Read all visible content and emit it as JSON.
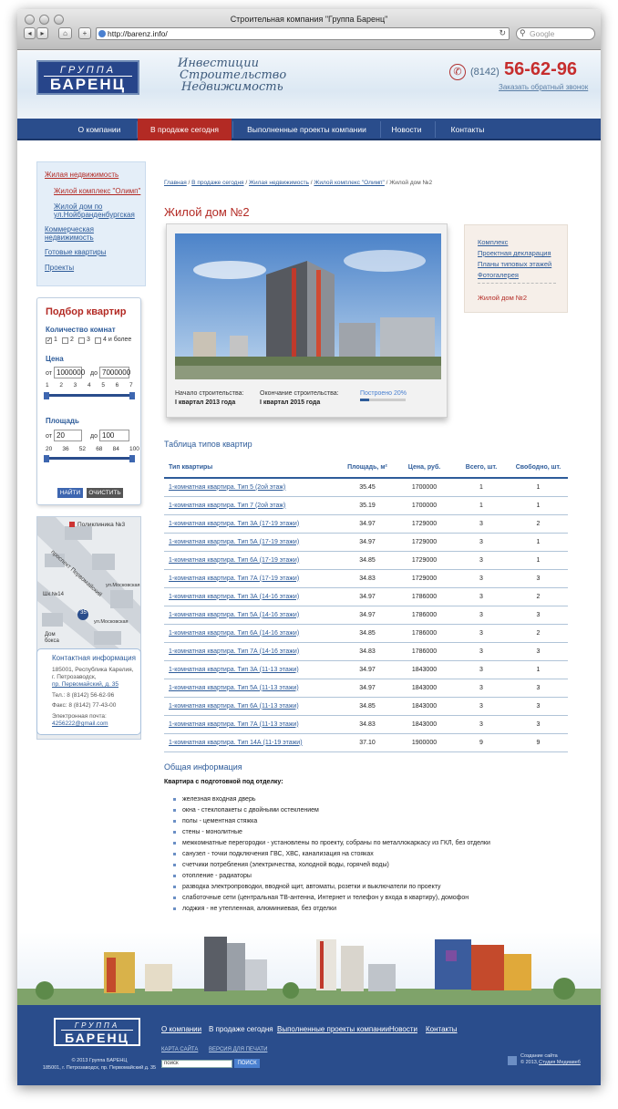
{
  "browser": {
    "title": "Строительная компания \"Группа Баренц\"",
    "url": "http://barenz.info/",
    "search_placeholder": "Google"
  },
  "header": {
    "logo_top": "ГРУППА",
    "logo_bottom": "БАРЕНЦ",
    "tagline": [
      "Инвестиции",
      "Строительство",
      "Недвижимость"
    ],
    "phone_code": "(8142)",
    "phone": "56-62-96",
    "callback": "Заказать обратный звонок"
  },
  "nav": [
    "О компании",
    "В продаже сегодня",
    "Выполненные проекты компании",
    "Новости",
    "Контакты"
  ],
  "leftmenu": {
    "items": [
      "Жилая недвижимость",
      "Жилой комплекс \"Олимп\"",
      "Жилой дом по",
      "ул.Нойбранденбургская",
      "Коммерческая",
      "недвижимость",
      "Готовые квартиры",
      "Проекты"
    ]
  },
  "filter": {
    "title": "Подбор квартир",
    "rooms_label": "Количество комнат",
    "rooms": [
      "1",
      "2",
      "3",
      "4 и более"
    ],
    "price_label": "Цена",
    "from": "от",
    "to": "до",
    "price_from": "1000000",
    "price_to": "7000000",
    "price_ticks": [
      "1",
      "2",
      "3",
      "4",
      "5",
      "6",
      "7"
    ],
    "area_label": "Площадь",
    "area_from": "20",
    "area_to": "100",
    "area_ticks": [
      "20",
      "36",
      "52",
      "68",
      "84",
      "100"
    ],
    "find": "НАЙТИ",
    "clear": "ОЧИСТИТЬ"
  },
  "map": {
    "clinic": "Поликлиника №3",
    "prospect": "проспект Первомайский",
    "street1": "ул.Московская",
    "street2": "ул.Московская",
    "school": "Шк.№14",
    "sport": "Дом",
    "sport2": "бокса",
    "num": "35"
  },
  "contact": {
    "title": "Контактная информация",
    "lines": [
      "185001, Республика Карелия,",
      "г. Петрозаводск,",
      "пр. Первомайский, д. 35",
      "Тел.: 8 (8142) 56-62-96",
      "Факс: 8 (8142) 77-43-00",
      "Электронная почта:",
      "4256222@gmail.com"
    ]
  },
  "breadcrumb": [
    "Главная",
    "В продаже сегодня",
    "Жилая недвижимость",
    "Жилой комплекс \"Олимп\"",
    "Жилой дом №2"
  ],
  "page_title": "Жилой дом №2",
  "photo_card": {
    "start_label": "Начало строительства:",
    "start_value": "I квартал 2013 года",
    "end_label": "Окончание строительства:",
    "end_value": "I квартал 2015 года",
    "progress_label": "Построено 20%",
    "progress": 0.2
  },
  "rightbox": {
    "links": [
      "Комплекс",
      "Проектная декларация",
      "Планы типовых этажей",
      "Фотогалерея"
    ],
    "current": "Жилой дом №2"
  },
  "table": {
    "title": "Таблица типов квартир",
    "headers": [
      "Тип квартиры",
      "Площадь, м²",
      "Цена, руб.",
      "Всего, шт.",
      "Свободно, шт."
    ],
    "rows": [
      [
        "1-комнатная квартира. Тип 5 (2ой этаж)",
        "35.45",
        "1700000",
        "1",
        "1"
      ],
      [
        "1-комнатная квартира. Тип 7 (2ой этаж)",
        "35.19",
        "1700000",
        "1",
        "1"
      ],
      [
        "1-комнатная квартира. Тип 3А (17-19 этажи)",
        "34.97",
        "1729000",
        "3",
        "2"
      ],
      [
        "1-комнатная квартира. Тип 5А (17-19 этажи)",
        "34.97",
        "1729000",
        "3",
        "1"
      ],
      [
        "1-комнатная квартира. Тип 6А (17-19 этажи)",
        "34.85",
        "1729000",
        "3",
        "1"
      ],
      [
        "1-комнатная квартира. Тип 7А (17-19 этажи)",
        "34.83",
        "1729000",
        "3",
        "3"
      ],
      [
        "1-комнатная квартира. Тип 3А (14-16 этажи)",
        "34.97",
        "1786000",
        "3",
        "2"
      ],
      [
        "1-комнатная квартира. Тип 5А (14-16 этажи)",
        "34.97",
        "1786000",
        "3",
        "3"
      ],
      [
        "1-комнатная квартира. Тип 6А (14-16 этажи)",
        "34.85",
        "1786000",
        "3",
        "2"
      ],
      [
        "1-комнатная квартира. Тип 7А (14-16 этажи)",
        "34.83",
        "1786000",
        "3",
        "3"
      ],
      [
        "1-комнатная квартира. Тип 3А (11-13 этажи)",
        "34.97",
        "1843000",
        "3",
        "1"
      ],
      [
        "1-комнатная квартира. Тип 5А (11-13 этажи)",
        "34.97",
        "1843000",
        "3",
        "3"
      ],
      [
        "1-комнатная квартира. Тип 6А (11-13 этажи)",
        "34.85",
        "1843000",
        "3",
        "3"
      ],
      [
        "1-комнатная квартира. Тип 7А (11-13 этажи)",
        "34.83",
        "1843000",
        "3",
        "3"
      ],
      [
        "1-комнатная квартира. Тип 14А (11-19 этажи)",
        "37.10",
        "1900000",
        "9",
        "9"
      ]
    ]
  },
  "info": {
    "title": "Общая информация",
    "subtitle": "Квартира с подготовкой под отделку:",
    "features": [
      "железная входная дверь",
      "окна - стеклопакеты с двойными остеклением",
      "полы - цементная стяжка",
      "стены - монолитные",
      "межкомнатные перегородки - установлены по проекту, собраны по металлокаркасу из ГКЛ, без отделки",
      "санузел - точки подключения ГВС, ХВС, канализация на стояках",
      "счетчики потребления (электричества, холодной воды, горячей воды)",
      "отопление - радиаторы",
      "разводка электропроводки, вводной щит, автоматы, розетки и выключатели по проекту",
      "слаботочные сети (центральная ТВ-антенна, Интернет и телефон у входа в квартиру), домофон",
      "лоджия - не утепленная, алюминиевая, без отделки"
    ]
  },
  "footer": {
    "links": [
      "О компании",
      "В продаже сегодня",
      "Выполненные проекты компании",
      "Новости",
      "Контакты"
    ],
    "sitemap": "КАРТА САЙТА",
    "print": "ВЕРСИЯ ДЛЯ ПЕЧАТИ",
    "search_value": "поиск",
    "search_btn": "ПОИСК",
    "copy1": "© 2013 Группа БАРЕНЦ",
    "copy2": "185001, г. Петрозаводск, пр. Первомайский д. 35",
    "dev1": "Создание сайта",
    "dev2": "© 2013,",
    "dev3": "Студия Медиавеб"
  },
  "colors": {
    "brand_blue": "#2a4d8c",
    "accent_red": "#b32a24",
    "link": "#2e5c9a"
  }
}
